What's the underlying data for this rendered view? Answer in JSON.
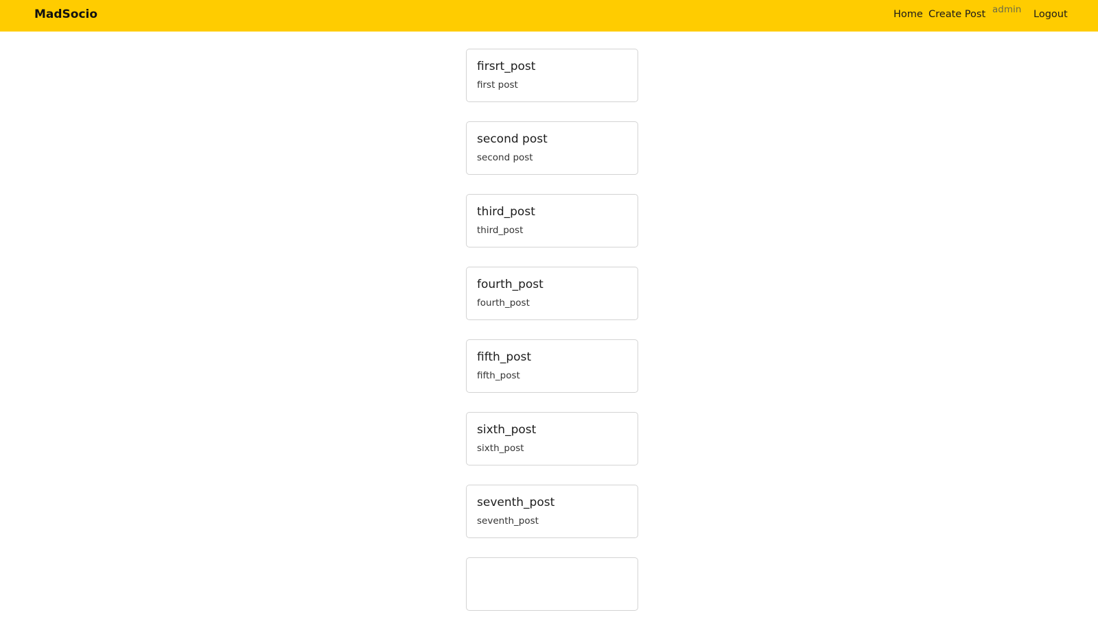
{
  "navbar": {
    "brand": "MadSocio",
    "home": "Home",
    "create_post": "Create Post",
    "username": "admin",
    "logout": "Logout",
    "bg_color": "#ffcc00"
  },
  "posts": [
    {
      "title": "firsrt_post",
      "body": "first post"
    },
    {
      "title": "second post",
      "body": "second post"
    },
    {
      "title": "third_post",
      "body": "third_post"
    },
    {
      "title": "fourth_post",
      "body": "fourth_post"
    },
    {
      "title": "fifth_post",
      "body": "fifth_post"
    },
    {
      "title": "sixth_post",
      "body": "sixth_post"
    },
    {
      "title": "seventh_post",
      "body": "seventh_post"
    },
    {
      "title": "",
      "body": ""
    }
  ]
}
